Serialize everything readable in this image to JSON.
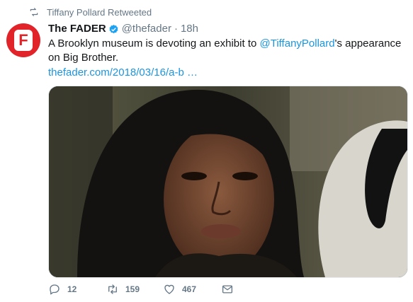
{
  "retweet_context": {
    "label": "Tiffany Pollard Retweeted",
    "icon": "retweet-icon"
  },
  "tweet": {
    "author_name": "The FADER",
    "verified": true,
    "handle": "@thefader",
    "separator": "·",
    "time": "18h",
    "avatar_letter": "F",
    "text_before": "A Brooklyn museum is devoting an exhibit to ",
    "mention": "@TiffanyPollard",
    "text_after": "'s appearance on Big Brother.",
    "link": "thefader.com/2018/03/16/a-b  …",
    "media_description_icon": "photo"
  },
  "actions": {
    "reply": {
      "icon": "reply-icon",
      "count": "12"
    },
    "retweet": {
      "icon": "retweet-icon",
      "count": "159"
    },
    "like": {
      "icon": "heart-icon",
      "count": "467"
    },
    "dm": {
      "icon": "envelope-icon"
    }
  },
  "colors": {
    "brand_red": "#e1242a",
    "link_blue": "#1b95e0",
    "muted_gray": "#657786",
    "verified_blue": "#1da1f2"
  }
}
